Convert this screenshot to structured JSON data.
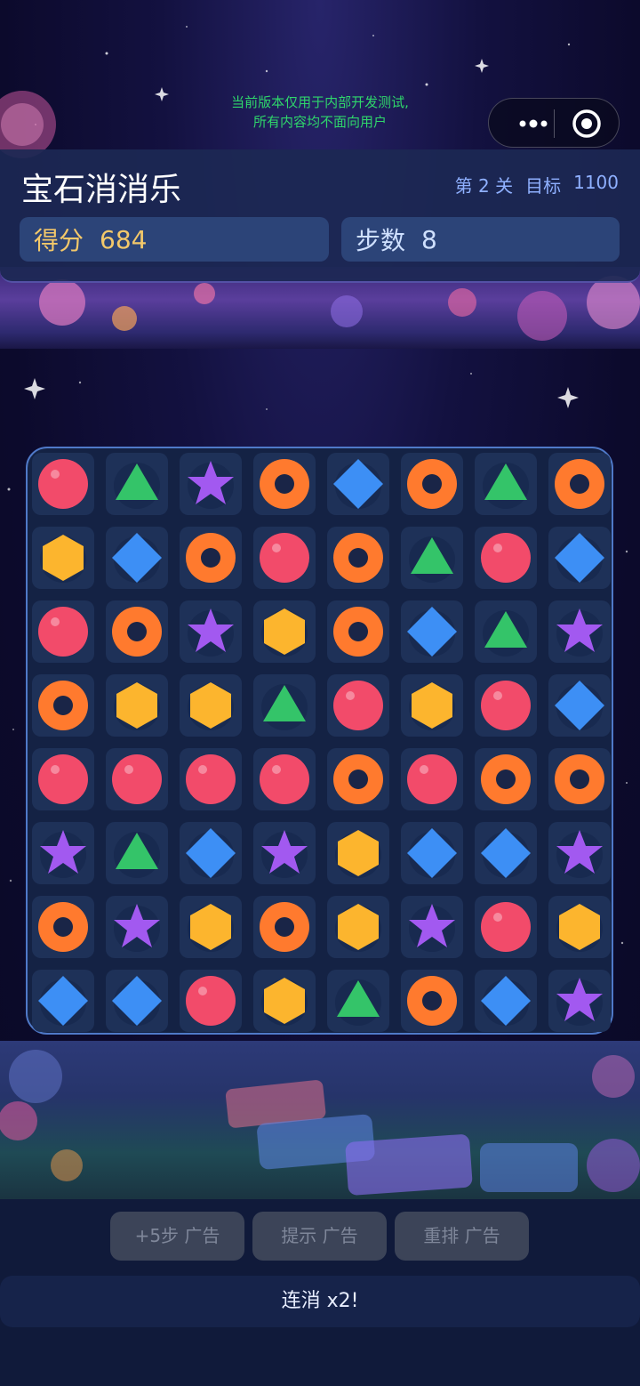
{
  "notice": {
    "line1": "当前版本仅用于内部开发测试,",
    "line2": "所有内容均不面向用户"
  },
  "header": {
    "title": "宝石消消乐",
    "level_label": "第 2 关",
    "target_label": "目标",
    "target_value": "1100",
    "score_label": "得分",
    "score_value": "684",
    "steps_label": "步数",
    "steps_value": "8"
  },
  "board": {
    "rows": [
      [
        "ball",
        "triangle",
        "star",
        "ring",
        "diamond",
        "ring",
        "triangle",
        "ring"
      ],
      [
        "hexagon",
        "diamond",
        "ring",
        "ball",
        "ring",
        "triangle",
        "ball",
        "diamond"
      ],
      [
        "ball",
        "ring",
        "star",
        "hexagon",
        "ring",
        "diamond",
        "triangle",
        "star"
      ],
      [
        "ring",
        "hexagon",
        "hexagon",
        "triangle",
        "ball",
        "hexagon",
        "ball",
        "diamond"
      ],
      [
        "ball",
        "ball",
        "ball",
        "ball",
        "ring",
        "ball",
        "ring",
        "ring"
      ],
      [
        "star",
        "triangle",
        "diamond",
        "star",
        "hexagon",
        "diamond",
        "diamond",
        "star"
      ],
      [
        "ring",
        "star",
        "hexagon",
        "ring",
        "hexagon",
        "star",
        "ball",
        "hexagon"
      ],
      [
        "diamond",
        "diamond",
        "ball",
        "hexagon",
        "triangle",
        "ring",
        "diamond",
        "star"
      ]
    ],
    "colors": {
      "ball": "#f24b6a",
      "triangle": "#34c469",
      "star": "#a259f0",
      "ring": "#ff7a2e",
      "diamond": "#3d8ff5",
      "hexagon": "#fcb52e"
    }
  },
  "buttons": {
    "add_steps": "+5步  广告",
    "hint": "提示  广告",
    "shuffle": "重排  广告"
  },
  "combo": "连消 x2!"
}
